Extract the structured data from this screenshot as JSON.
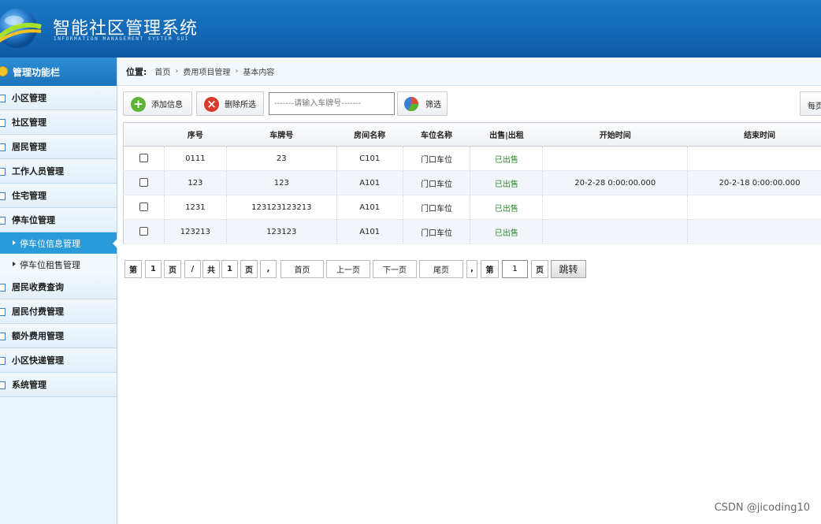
{
  "header": {
    "title": "智能社区管理系统",
    "subtitle": "INFORMATION MANAGEMENT SYSTEM GUI"
  },
  "sidebar": {
    "title": "管理功能栏",
    "items": [
      {
        "label": "小区管理"
      },
      {
        "label": "社区管理"
      },
      {
        "label": "居民管理"
      },
      {
        "label": "工作人员管理"
      },
      {
        "label": "住宅管理"
      },
      {
        "label": "停车位管理"
      }
    ],
    "subitems": [
      {
        "label": "停车位信息管理",
        "active": true
      },
      {
        "label": "停车位租售管理",
        "active": false
      }
    ],
    "items_after": [
      {
        "label": "居民收费查询"
      },
      {
        "label": "居民付费管理"
      },
      {
        "label": "额外费用管理"
      },
      {
        "label": "小区快递管理"
      },
      {
        "label": "系统管理"
      }
    ]
  },
  "breadcrumb": {
    "label": "位置:",
    "items": [
      "首页",
      "费用项目管理",
      "基本内容"
    ]
  },
  "toolbar": {
    "add_label": "添加信息",
    "delete_label": "删除所选",
    "search_placeholder": "-------请输入车牌号-------",
    "filter_label": "筛选",
    "per_page_label": "每页"
  },
  "table": {
    "headers": [
      "",
      "序号",
      "车牌号",
      "房间名称",
      "车位名称",
      "出售|出租",
      "开始时间",
      "结束时间"
    ],
    "rows": [
      {
        "id": "0111",
        "plate": "23",
        "room": "C101",
        "slot": "门口车位",
        "status": "已出售",
        "start": "",
        "end": ""
      },
      {
        "id": "123",
        "plate": "123",
        "room": "A101",
        "slot": "门口车位",
        "status": "已出售",
        "start": "20-2-28 0:00:00.000",
        "end": "20-2-18 0:00:00.000"
      },
      {
        "id": "1231",
        "plate": "123123123213",
        "room": "A101",
        "slot": "门口车位",
        "status": "已出售",
        "start": "",
        "end": ""
      },
      {
        "id": "123213",
        "plate": "123123",
        "room": "A101",
        "slot": "门口车位",
        "status": "已出售",
        "start": "",
        "end": ""
      }
    ]
  },
  "pager": {
    "di": "第",
    "current": "1",
    "ye": "页",
    "slash": "/",
    "gong": "共",
    "total": "1",
    "ye2": "页",
    "comma": ",",
    "first": "首页",
    "prev": "上一页",
    "next": "下一页",
    "last": "尾页",
    "comma2": ",",
    "di2": "第",
    "input_value": "1",
    "ye3": "页",
    "jump": "跳转"
  },
  "watermark": "CSDN @jicoding10"
}
